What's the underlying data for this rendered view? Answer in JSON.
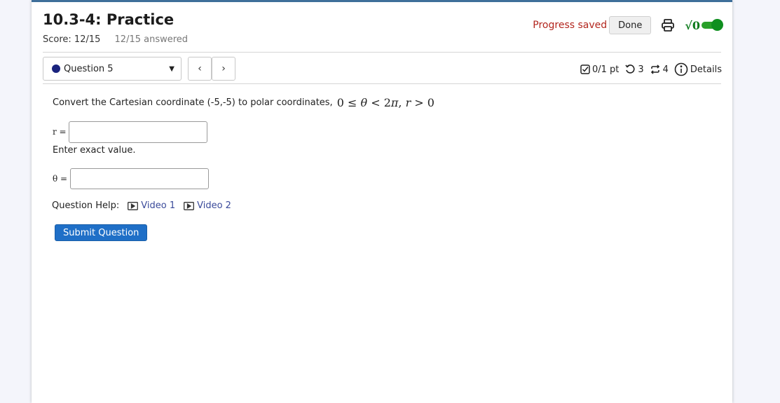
{
  "header": {
    "title": "10.3-4: Practice",
    "score": "Score: 12/15",
    "answered": "12/15 answered",
    "progress_saved": "Progress saved",
    "done_label": "Done",
    "sqrt_toggle_label": "√0"
  },
  "question_bar": {
    "selected_question": "Question 5",
    "prev_label": "‹",
    "next_label": "›",
    "points": "0/1 pt",
    "retries": "3",
    "attempts": "4",
    "details_label": "Details"
  },
  "question": {
    "prompt": "Convert the Cartesian coordinate (-5,-5) to polar coordinates,",
    "constraint_prefix": "0 ≤ ",
    "constraint_theta": "θ",
    "constraint_mid": " < 2",
    "constraint_pi": "π",
    "constraint_sep": ", ",
    "constraint_r": "r",
    "constraint_suffix": " > 0",
    "r_label": "r =",
    "r_value": "",
    "hint": "Enter exact value.",
    "theta_label": "θ =",
    "theta_value": ""
  },
  "help": {
    "label": "Question Help:",
    "video1": "Video 1",
    "video2": "Video 2"
  },
  "submit_label": "Submit Question",
  "colors": {
    "accent": "#1f6fc7",
    "progress_saved": "#b3261e",
    "toggle": "#0f8f1f",
    "question_dot": "#1a237e"
  }
}
